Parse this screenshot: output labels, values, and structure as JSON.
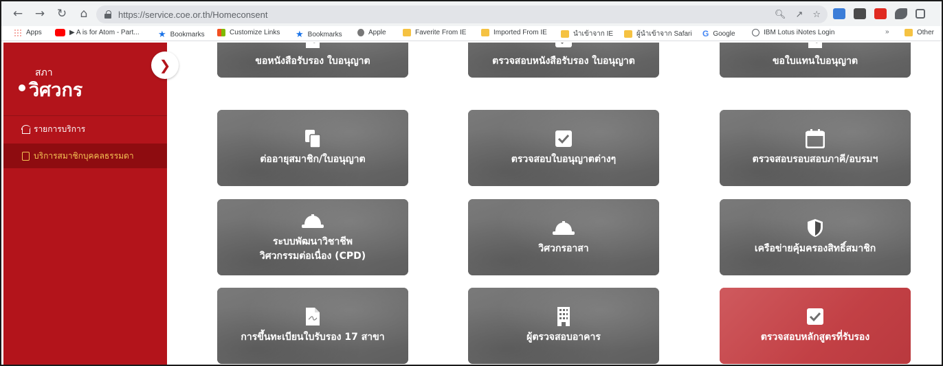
{
  "browser": {
    "url": "https://service.coe.or.th/Homeconsent",
    "bookmarks": [
      {
        "label": "Apps",
        "icon": "apps-grid-icon",
        "color": "#1a73e8"
      },
      {
        "label": "▶ A is for Atom - Part...",
        "icon": "youtube-icon",
        "color": "#ff0000"
      },
      {
        "label": "Bookmarks",
        "icon": "star-icon",
        "color": "#1a73e8"
      },
      {
        "label": "Customize Links",
        "icon": "windows-icon",
        "color": "#f25022"
      },
      {
        "label": "Bookmarks",
        "icon": "star-icon",
        "color": "#1a73e8"
      },
      {
        "label": "Apple",
        "icon": "apple-icon",
        "color": "#777777"
      },
      {
        "label": "Faverite From IE",
        "icon": "folder-icon",
        "color": "#f5c242"
      },
      {
        "label": "Imported From IE",
        "icon": "folder-icon",
        "color": "#f5c242"
      },
      {
        "label": "นำเข้าจาก IE",
        "icon": "folder-icon",
        "color": "#f5c242"
      },
      {
        "label": "ผู้นำเข้าจาก Safari",
        "icon": "folder-icon",
        "color": "#f5c242"
      },
      {
        "label": "Google",
        "icon": "google-icon",
        "color": "#4285f4"
      },
      {
        "label": "IBM Lotus iNotes Login",
        "icon": "globe-icon",
        "color": "#5f6368"
      },
      {
        "label": "Other",
        "icon": "folder-icon",
        "color": "#f5c242"
      }
    ],
    "overflow_label": "»"
  },
  "sidebar": {
    "logo_small": "สภา",
    "logo_big": "วิศวกร",
    "items": [
      {
        "label": "รายการบริการ",
        "icon": "home-icon"
      },
      {
        "label": "บริการสมาชิกบุคคลธรรมดา",
        "icon": "clipboard-icon"
      }
    ]
  },
  "cards": [
    {
      "label": "ขอหนังสือรับรอง ใบอนุญาต",
      "icon": "document-icon"
    },
    {
      "label": "ตรวจสอบหนังสือรับรอง ใบอนุญาต",
      "icon": "check-square-icon"
    },
    {
      "label": "ขอใบแทนใบอนุญาต",
      "icon": "document-icon"
    },
    {
      "label": "ต่ออายุสมาชิก/ใบอนุญาต",
      "icon": "copy-files-icon"
    },
    {
      "label": "ตรวจสอบใบอนุญาตต่างๆ",
      "icon": "check-square-icon"
    },
    {
      "label": "ตรวจสอบรอบสอบภาคี/อบรมฯ",
      "icon": "calendar-icon"
    },
    {
      "label": "ระบบพัฒนาวิชาชีพ",
      "label2": "วิศวกรรมต่อเนื่อง (CPD)",
      "icon": "hard-hat-icon"
    },
    {
      "label": "วิศวกรอาสา",
      "icon": "hard-hat-icon"
    },
    {
      "label": "เครือข่ายคุ้มครองสิทธิ์สมาชิก",
      "icon": "shield-icon"
    },
    {
      "label": "การขึ้นทะเบียนใบรับรอง 17 สาขา",
      "icon": "document-icon"
    },
    {
      "label": "ผู้ตรวจสอบอาคาร",
      "icon": "building-icon"
    },
    {
      "label": "ตรวจสอบหลักสูตรที่รับรอง",
      "icon": "check-square-icon"
    }
  ],
  "colors": {
    "sidebar": "#b3141b",
    "sidebar_active": "#8e0c10",
    "active_text": "#f6c454",
    "card": "#6e6e6e",
    "card_highlight": "#c84a4e"
  }
}
